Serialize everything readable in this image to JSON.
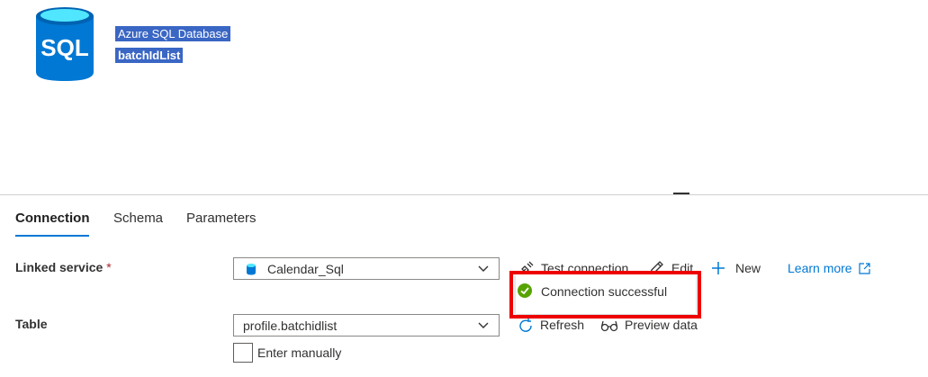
{
  "header": {
    "icon": "sql-database-icon",
    "icon_text": "SQL",
    "type": "Azure SQL Database",
    "name": "batchIdList"
  },
  "tabs": [
    {
      "label": "Connection",
      "active": true
    },
    {
      "label": "Schema",
      "active": false
    },
    {
      "label": "Parameters",
      "active": false
    }
  ],
  "linked_service": {
    "label": "Linked service",
    "required_mark": "*",
    "value": "Calendar_Sql",
    "actions": {
      "test_connection": "Test connection",
      "edit": "Edit",
      "new": "New"
    },
    "learn_more": "Learn more"
  },
  "popup": {
    "text": "Connection successful",
    "status": "success"
  },
  "table": {
    "label": "Table",
    "value": "profile.batchidlist",
    "actions": {
      "refresh": "Refresh",
      "preview": "Preview data"
    },
    "enter_manually": {
      "label": "Enter manually",
      "checked": false
    }
  },
  "colors": {
    "accent": "#0078d4",
    "highlight_border": "#ee0000",
    "success": "#57a300",
    "sql_icon": "#0078d4",
    "header_selection": "#3a66c4"
  }
}
